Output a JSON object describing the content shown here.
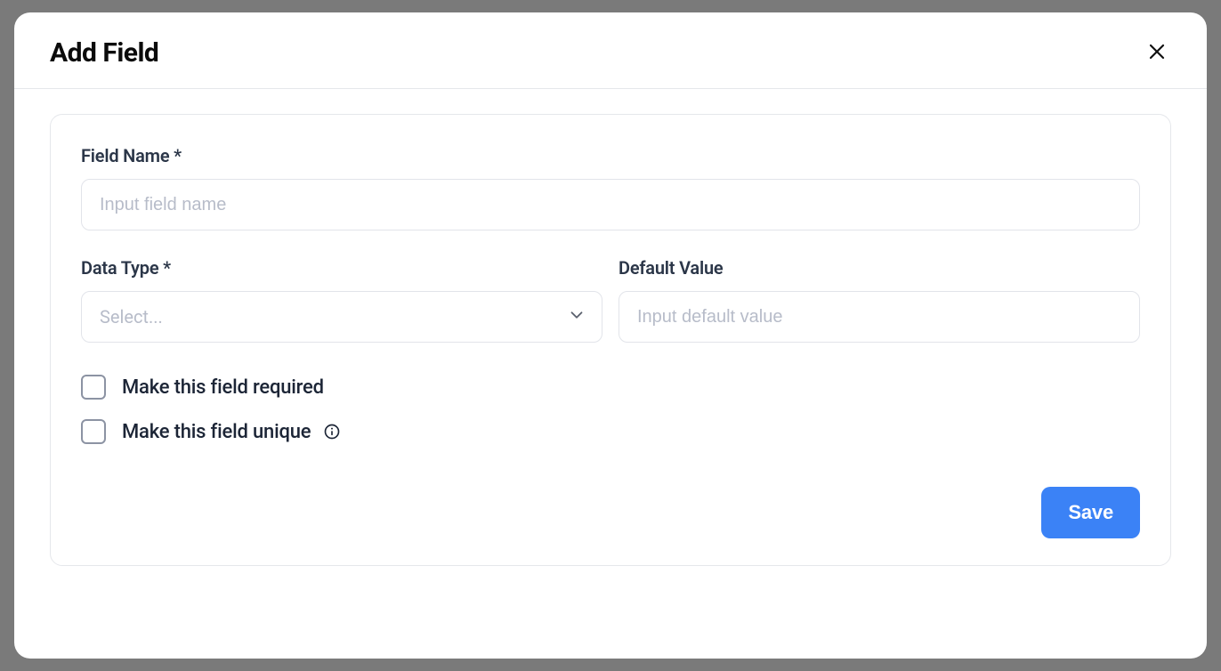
{
  "modal": {
    "title": "Add Field",
    "close_icon": "close-icon"
  },
  "form": {
    "field_name": {
      "label": "Field Name *",
      "placeholder": "Input field name",
      "value": ""
    },
    "data_type": {
      "label": "Data Type *",
      "placeholder": "Select...",
      "value": ""
    },
    "default_value": {
      "label": "Default Value",
      "placeholder": "Input default value",
      "value": ""
    },
    "required_checkbox": {
      "label": "Make this field required",
      "checked": false
    },
    "unique_checkbox": {
      "label": "Make this field unique",
      "checked": false,
      "info_icon": "info-icon"
    },
    "save_button": "Save"
  }
}
